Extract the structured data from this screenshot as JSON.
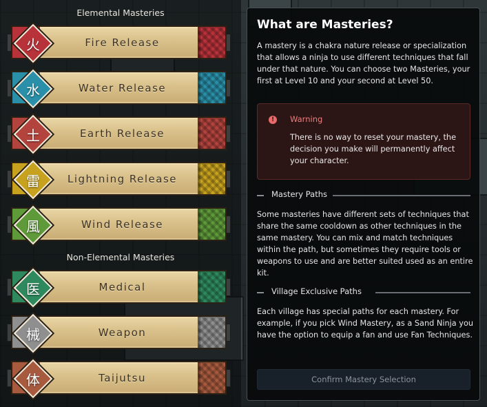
{
  "left": {
    "elemental_title": "Elemental Masteries",
    "non_elemental_title": "Non-Elemental Masteries",
    "elemental": [
      {
        "label": "Fire Release",
        "glyph": "火",
        "color": "#b8323a",
        "icon": "fire-kanji-icon"
      },
      {
        "label": "Water Release",
        "glyph": "水",
        "color": "#2a8fa8",
        "icon": "water-kanji-icon"
      },
      {
        "label": "Earth Release",
        "glyph": "土",
        "color": "#b3443d",
        "icon": "earth-kanji-icon"
      },
      {
        "label": "Lightning Release",
        "glyph": "雷",
        "color": "#c7a21f",
        "icon": "lightning-kanji-icon"
      },
      {
        "label": "Wind Release",
        "glyph": "風",
        "color": "#5f9a3a",
        "icon": "wind-kanji-icon"
      }
    ],
    "non_elemental": [
      {
        "label": "Medical",
        "glyph": "医",
        "color": "#2e8a5e",
        "icon": "medical-kanji-icon"
      },
      {
        "label": "Weapon",
        "glyph": "械",
        "color": "#8f8f8f",
        "icon": "weapon-kanji-icon"
      },
      {
        "label": "Taijutsu",
        "glyph": "体",
        "color": "#a85a3e",
        "icon": "taijutsu-kanji-icon"
      }
    ]
  },
  "panel": {
    "title": "What are Masteries?",
    "intro": "A mastery is a chakra nature release or specialization that allows a ninja to use different techniques that fall under that nature. You can choose two Masteries, your first at Level 10 and your second at Level 50.",
    "warning": {
      "title": "Warning",
      "body": "There is no way to reset your mastery, the decision you make will permanently affect your character."
    },
    "paths_heading": "Mastery Paths",
    "paths_text": "Some masteries have different sets of techniques that share the same cooldown as other techniques in the same mastery. You can mix and match techniques within the path, but sometimes they require tools or weapons to use and are better suited used as an entire kit.",
    "village_heading": "Village Exclusive Paths",
    "village_text": "Each village has special paths for each mastery. For example, if you pick Wind Mastery, as a Sand Ninja you have the option to equip a fan and use Fan Techniques.",
    "confirm_label": "Confirm Mastery Selection"
  },
  "colors": {
    "panel_bg": "#08090b",
    "warning_text": "#ef7f7f",
    "confirm_disabled_text": "#8e949a"
  }
}
